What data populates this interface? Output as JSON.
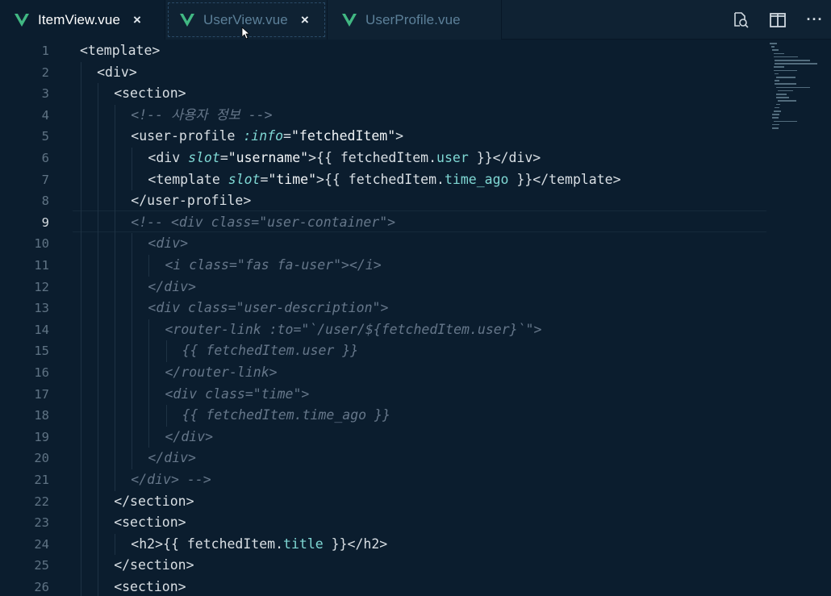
{
  "tabs": [
    {
      "label": "ItemView.vue",
      "icon": "vue-icon",
      "state": "active",
      "close": "×"
    },
    {
      "label": "UserView.vue",
      "icon": "vue-icon",
      "state": "inactive",
      "close": "×"
    },
    {
      "label": "UserProfile.vue",
      "icon": "vue-icon",
      "state": "inactive"
    }
  ],
  "actions": [
    {
      "icon": "search-file-icon"
    },
    {
      "icon": "split-editor-icon"
    },
    {
      "icon": "more-icon",
      "glyph": "···"
    }
  ],
  "editor": {
    "current_line": 9,
    "line_numbers": [
      "1",
      "2",
      "3",
      "4",
      "5",
      "6",
      "7",
      "8",
      "9",
      "10",
      "11",
      "12",
      "13",
      "14",
      "15",
      "16",
      "17",
      "18",
      "19",
      "20",
      "21",
      "22",
      "23",
      "24",
      "25",
      "26"
    ],
    "lines": [
      {
        "indent": 0,
        "tokens": [
          {
            "k": "t",
            "v": "<template>"
          }
        ]
      },
      {
        "indent": 1,
        "tokens": [
          {
            "k": "t",
            "v": "<div>"
          }
        ]
      },
      {
        "indent": 2,
        "tokens": [
          {
            "k": "t",
            "v": "<section>"
          }
        ]
      },
      {
        "indent": 3,
        "tokens": [
          {
            "k": "c",
            "v": "<!-- 사용자 정보 -->"
          }
        ]
      },
      {
        "indent": 3,
        "tokens": [
          {
            "k": "t",
            "v": "<user-profile "
          },
          {
            "k": "a",
            "v": ":info"
          },
          {
            "k": "t",
            "v": "="
          },
          {
            "k": "s",
            "v": "\"fetchedItem\""
          },
          {
            "k": "t",
            "v": ">"
          }
        ]
      },
      {
        "indent": 4,
        "tokens": [
          {
            "k": "t",
            "v": "<div "
          },
          {
            "k": "a",
            "v": "slot"
          },
          {
            "k": "t",
            "v": "="
          },
          {
            "k": "s",
            "v": "\"username\""
          },
          {
            "k": "t",
            "v": ">{{ fetchedItem."
          },
          {
            "k": "p",
            "v": "user"
          },
          {
            "k": "t",
            "v": " }}</div>"
          }
        ]
      },
      {
        "indent": 4,
        "tokens": [
          {
            "k": "t",
            "v": "<template "
          },
          {
            "k": "a",
            "v": "slot"
          },
          {
            "k": "t",
            "v": "="
          },
          {
            "k": "s",
            "v": "\"time\""
          },
          {
            "k": "t",
            "v": ">{{ fetchedItem."
          },
          {
            "k": "p",
            "v": "time_ago"
          },
          {
            "k": "t",
            "v": " }}</template>"
          }
        ]
      },
      {
        "indent": 3,
        "tokens": [
          {
            "k": "t",
            "v": "</user-profile>"
          }
        ]
      },
      {
        "indent": 3,
        "tokens": [
          {
            "k": "c",
            "v": "<!-- <div class=\"user-container\">"
          }
        ]
      },
      {
        "indent": 4,
        "tokens": [
          {
            "k": "c",
            "v": "<div>"
          }
        ]
      },
      {
        "indent": 5,
        "tokens": [
          {
            "k": "c",
            "v": "<i class=\"fas fa-user\"></i>"
          }
        ]
      },
      {
        "indent": 4,
        "tokens": [
          {
            "k": "c",
            "v": "</div>"
          }
        ]
      },
      {
        "indent": 4,
        "tokens": [
          {
            "k": "c",
            "v": "<div class=\"user-description\">"
          }
        ]
      },
      {
        "indent": 5,
        "tokens": [
          {
            "k": "c",
            "v": "<router-link :to=\"`/user/${fetchedItem.user}`\">"
          }
        ]
      },
      {
        "indent": 6,
        "tokens": [
          {
            "k": "c",
            "v": "{{ fetchedItem.user }}"
          }
        ]
      },
      {
        "indent": 5,
        "tokens": [
          {
            "k": "c",
            "v": "</router-link>"
          }
        ]
      },
      {
        "indent": 5,
        "tokens": [
          {
            "k": "c",
            "v": "<div class=\"time\">"
          }
        ]
      },
      {
        "indent": 6,
        "tokens": [
          {
            "k": "c",
            "v": "{{ fetchedItem.time_ago }}"
          }
        ]
      },
      {
        "indent": 5,
        "tokens": [
          {
            "k": "c",
            "v": "</div>"
          }
        ]
      },
      {
        "indent": 4,
        "tokens": [
          {
            "k": "c",
            "v": "</div>"
          }
        ]
      },
      {
        "indent": 3,
        "tokens": [
          {
            "k": "c",
            "v": "</div> -->"
          }
        ]
      },
      {
        "indent": 2,
        "tokens": [
          {
            "k": "t",
            "v": "</section>"
          }
        ]
      },
      {
        "indent": 2,
        "tokens": [
          {
            "k": "t",
            "v": "<section>"
          }
        ]
      },
      {
        "indent": 3,
        "tokens": [
          {
            "k": "t",
            "v": "<h2>{{ fetchedItem."
          },
          {
            "k": "p",
            "v": "title"
          },
          {
            "k": "t",
            "v": " }}</h2>"
          }
        ]
      },
      {
        "indent": 2,
        "tokens": [
          {
            "k": "t",
            "v": "</section>"
          }
        ]
      },
      {
        "indent": 2,
        "tokens": [
          {
            "k": "t",
            "v": "<section>"
          }
        ]
      }
    ]
  },
  "colors": {
    "background": "#0b1d2e",
    "tab_bar": "#0f2233",
    "vue_green": "#41b883",
    "attribute": "#7fd8d4",
    "comment": "#66778a",
    "text": "#d9dfe4"
  }
}
